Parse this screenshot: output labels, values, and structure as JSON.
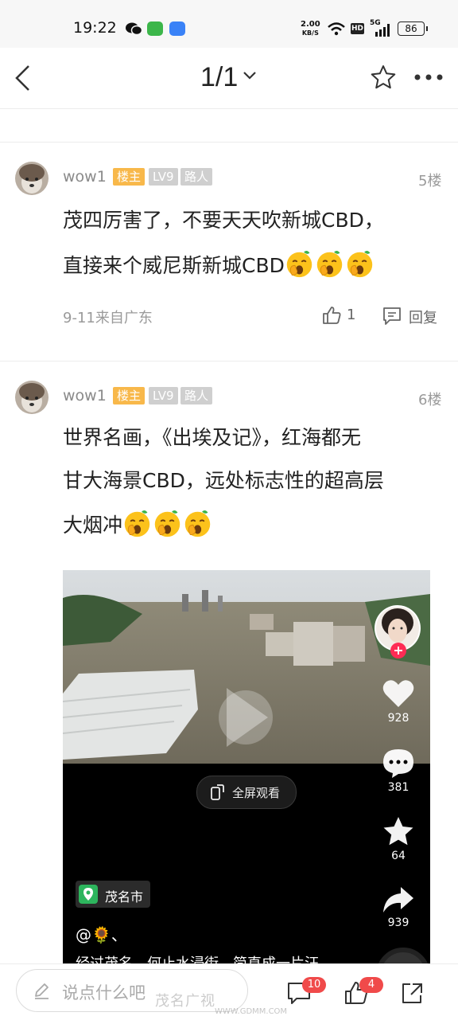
{
  "status_bar": {
    "time": "19:22",
    "net_speed_value": "2.00",
    "net_speed_unit": "KB/S",
    "hd": "HD",
    "network": "5G",
    "battery": "86"
  },
  "header": {
    "page_indicator": "1/1"
  },
  "posts": [
    {
      "username": "wow1",
      "badge_owner": "楼主",
      "badge_level": "LV9",
      "badge_role": "路人",
      "floor": "5楼",
      "lines": [
        "茂四厉害了，不要天天吹新城CBD，",
        "直接来个威尼斯新城CBD"
      ],
      "emoji_count": 3,
      "meta": "9-11来自广东",
      "likes": "1",
      "reply_label": "回复"
    },
    {
      "username": "wow1",
      "badge_owner": "楼主",
      "badge_level": "LV9",
      "badge_role": "路人",
      "floor": "6楼",
      "lines": [
        "世界名画，《出埃及记》，红海都无",
        "甘大海景CBD，远处标志性的超高层",
        "大烟冲"
      ],
      "emoji_count": 3
    }
  ],
  "video": {
    "fullscreen_label": "全屏观看",
    "likes": "928",
    "comments": "381",
    "favorites": "64",
    "shares": "939",
    "location": "茂名市",
    "caption_line1": "@🌻、",
    "caption_line2": "经过茂名，何止水浸街，简直成一片汪"
  },
  "bottom_bar": {
    "comment_placeholder": "说点什么吧",
    "comment_count": "10",
    "like_count": "4",
    "watermark": "茂名广视",
    "watermark_url": "WWW.GDMM.COM"
  },
  "colors": {
    "owner_badge": "#f8b84a",
    "level_badge": "#cfcfcf",
    "count_badge": "#f04a4a",
    "wechat_green": "#1aad19",
    "messages_green": "#3cb64a",
    "app_blue": "#3a82f7"
  },
  "icons": [
    "back-arrow-icon",
    "chevron-down-icon",
    "star-icon",
    "more-icon",
    "thumbs-up-icon",
    "reply-icon",
    "play-icon",
    "heart-icon",
    "comment-bubble-icon",
    "share-arrow-icon",
    "location-pin-icon",
    "pencil-icon",
    "message-icon",
    "share-icon"
  ]
}
